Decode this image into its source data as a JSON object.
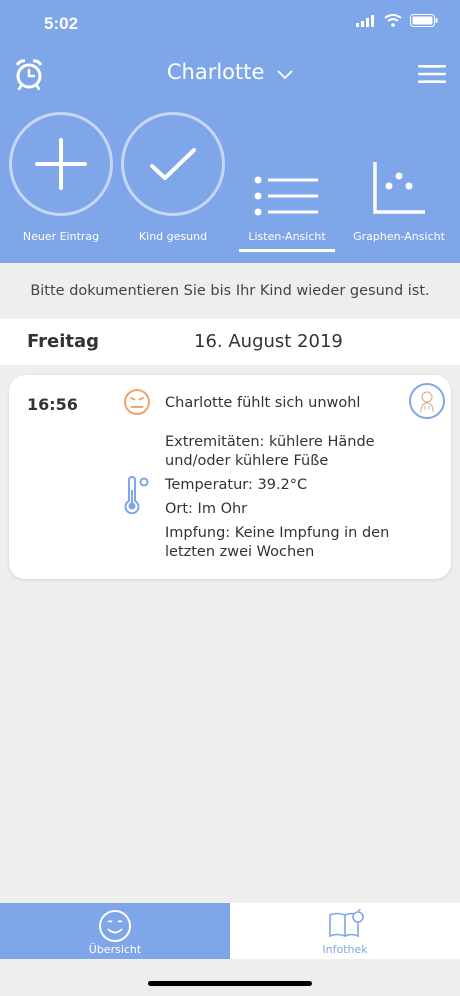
{
  "status": {
    "time": "5:02"
  },
  "header": {
    "title": "Charlotte",
    "actions": [
      {
        "label": "Neuer Eintrag"
      },
      {
        "label": "Kind gesund"
      },
      {
        "label": "Listen-Ansicht"
      },
      {
        "label": "Graphen-Ansicht"
      }
    ]
  },
  "notice": "Bitte dokumentieren Sie bis Ihr Kind wieder gesund ist.",
  "day": {
    "weekday": "Freitag",
    "date": "16. August 2019"
  },
  "entry": {
    "time": "16:56",
    "mood": "Charlotte fühlt sich unwohl",
    "extremities": "Extremitäten: kühlere Hände und/oder kühlere Füße",
    "temperature": "Temperatur: 39.2°C",
    "location": "Ort: Im Ohr",
    "vaccination": "Impfung: Keine Impfung in den letzten zwei Wochen"
  },
  "tabs": [
    {
      "label": "Übersicht"
    },
    {
      "label": "Infothek"
    }
  ],
  "colors": {
    "accent": "#7ea6e8",
    "mood": "#f0a36b",
    "background": "#eeeeee"
  }
}
